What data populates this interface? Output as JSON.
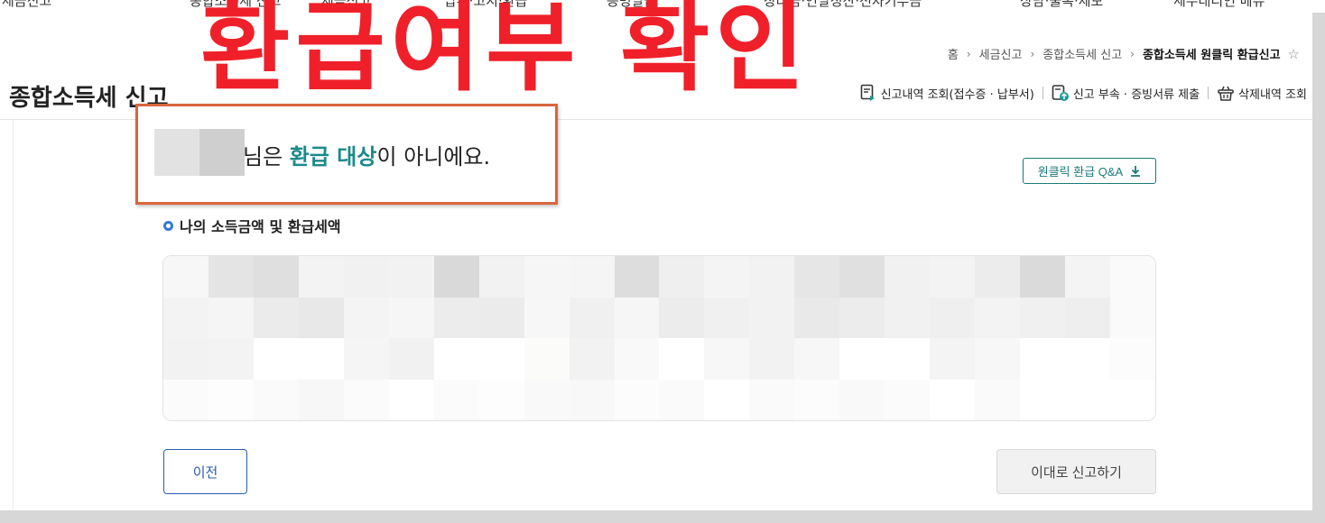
{
  "top_menu": {
    "items": [
      "세금신고",
      "종합소득세 신고",
      "세금신고",
      "납부·고지·환급",
      "증명발급",
      "장려금·연말정산·전자기부금",
      "상담·불복·제보",
      "세무대리인 메뉴"
    ]
  },
  "overlay": {
    "heading": "환급여부 확인"
  },
  "breadcrumb": {
    "items": [
      "홈",
      "세금신고",
      "종합소득세 신고",
      "종합소득세 원클릭 환급신고"
    ],
    "separator": "›",
    "favorite_icon": "star-outline-icon"
  },
  "page": {
    "title": "종합소득세 신고"
  },
  "utility_links": [
    {
      "label": "신고내역 조회(접수증 · 납부서)",
      "icon": "document-search-icon"
    },
    {
      "label": "신고 부속 · 증빙서류 제출",
      "icon": "document-upload-icon"
    },
    {
      "label": "삭제내역 조회",
      "icon": "trash-basket-icon"
    }
  ],
  "notice": {
    "suffix": "님은 ",
    "highlight": "환급 대상",
    "tail": "이 아니에요."
  },
  "qa_button": {
    "label": "원클릭 환급 Q&A",
    "icon": "download-icon"
  },
  "section": {
    "heading": "나의 소득금액 및 환급세액"
  },
  "buttons": {
    "prev": "이전",
    "submit": "이대로 신고하기"
  },
  "colors": {
    "accent_red": "#f0202a",
    "teal": "#1b8a8a",
    "highlight_border": "#d9663d",
    "link_blue": "#2a5db0"
  }
}
